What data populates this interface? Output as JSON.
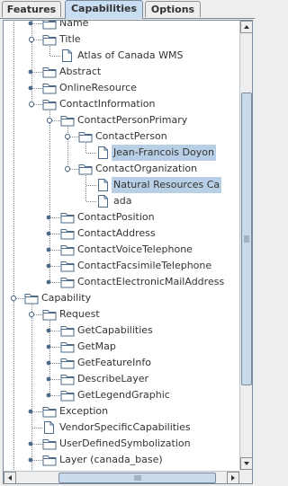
{
  "tabs": [
    {
      "label": "Features",
      "selected": false
    },
    {
      "label": "Capabilities",
      "selected": true
    },
    {
      "label": "Options",
      "selected": false
    }
  ],
  "tree": [
    {
      "label": "Name",
      "kind": "folder",
      "level": 2,
      "expander": "dot"
    },
    {
      "label": "Title",
      "kind": "folder",
      "level": 2,
      "expander": "open"
    },
    {
      "label": "Atlas of Canada WMS",
      "kind": "doc",
      "level": 3
    },
    {
      "label": "Abstract",
      "kind": "folder",
      "level": 2,
      "expander": "dot"
    },
    {
      "label": "OnlineResource",
      "kind": "folder",
      "level": 2,
      "expander": "dot"
    },
    {
      "label": "ContactInformation",
      "kind": "folder",
      "level": 2,
      "expander": "open"
    },
    {
      "label": "ContactPersonPrimary",
      "kind": "folder",
      "level": 3,
      "expander": "open"
    },
    {
      "label": "ContactPerson",
      "kind": "folder",
      "level": 4,
      "expander": "open"
    },
    {
      "label": "Jean-Francois Doyon",
      "kind": "doc",
      "level": 5,
      "selected": true
    },
    {
      "label": "ContactOrganization",
      "kind": "folder",
      "level": 4,
      "expander": "open"
    },
    {
      "label": "Natural Resources Ca",
      "kind": "doc",
      "level": 5,
      "selected": true
    },
    {
      "label": "ada",
      "kind": "doc",
      "level": 5
    },
    {
      "label": "ContactPosition",
      "kind": "folder",
      "level": 3,
      "expander": "dot"
    },
    {
      "label": "ContactAddress",
      "kind": "folder",
      "level": 3,
      "expander": "dot"
    },
    {
      "label": "ContactVoiceTelephone",
      "kind": "folder",
      "level": 3,
      "expander": "dot"
    },
    {
      "label": "ContactFacsimileTelephone",
      "kind": "folder",
      "level": 3,
      "expander": "dot"
    },
    {
      "label": "ContactElectronicMailAddress",
      "kind": "folder",
      "level": 3,
      "expander": "dot"
    },
    {
      "label": "Capability",
      "kind": "folder",
      "level": 1,
      "expander": "open"
    },
    {
      "label": "Request",
      "kind": "folder",
      "level": 2,
      "expander": "open"
    },
    {
      "label": "GetCapabilities",
      "kind": "folder",
      "level": 3,
      "expander": "dot"
    },
    {
      "label": "GetMap",
      "kind": "folder",
      "level": 3,
      "expander": "dot"
    },
    {
      "label": "GetFeatureInfo",
      "kind": "folder",
      "level": 3,
      "expander": "dot"
    },
    {
      "label": "DescribeLayer",
      "kind": "folder",
      "level": 3,
      "expander": "dot"
    },
    {
      "label": "GetLegendGraphic",
      "kind": "folder",
      "level": 3,
      "expander": "dot"
    },
    {
      "label": "Exception",
      "kind": "folder",
      "level": 2,
      "expander": "dot"
    },
    {
      "label": "VendorSpecificCapabilities",
      "kind": "doc",
      "level": 2
    },
    {
      "label": "UserDefinedSymbolization",
      "kind": "folder",
      "level": 2,
      "expander": "dot"
    },
    {
      "label": "Layer (canada_base)",
      "kind": "folder",
      "level": 2,
      "expander": "dot"
    }
  ],
  "colors": {
    "selected_tab": "#c8ddf2",
    "selection": "#b8cfe5",
    "folder": "#4d6b8a",
    "scroll_thumb": "#c8daeb"
  },
  "icons": {
    "folder": "folder-icon",
    "doc": "document-icon",
    "expanded": "collapse-handle-icon",
    "collapsed": "expand-handle-icon"
  },
  "scrollbars": {
    "vertical_position": 0.14,
    "vertical_visible_fraction": 0.69,
    "horizontal_position": 0.2,
    "horizontal_visible_fraction": 0.75
  }
}
